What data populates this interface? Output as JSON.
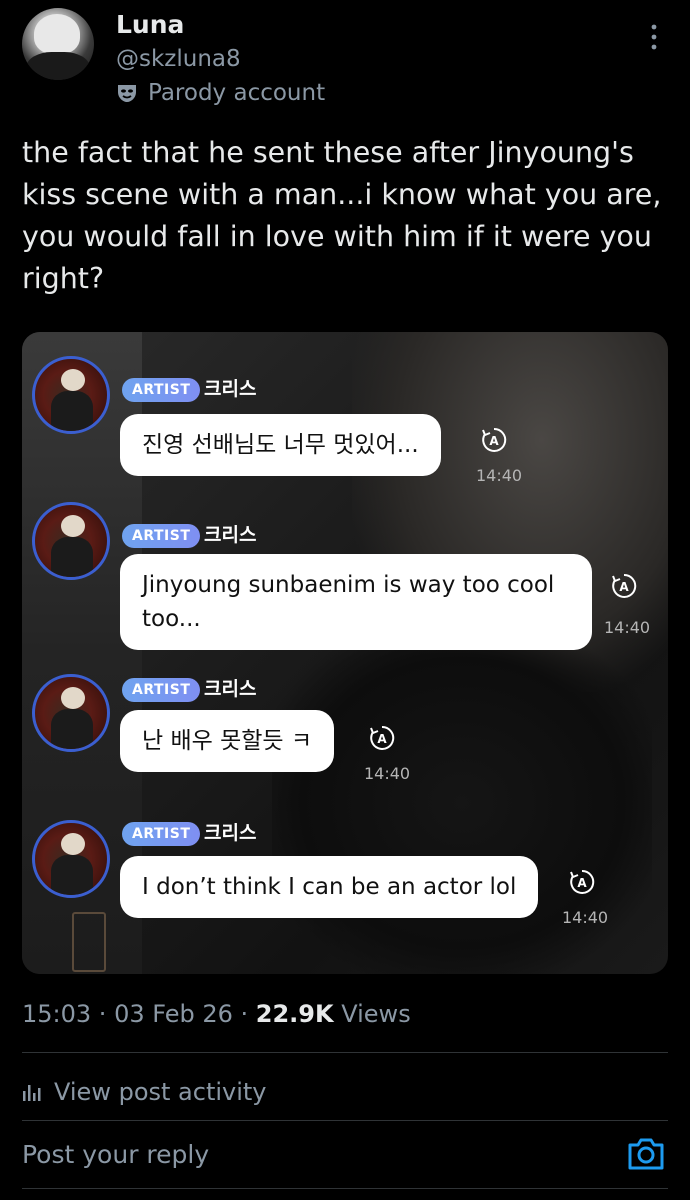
{
  "profile": {
    "name": "Luna",
    "handle": "@skzluna8",
    "label": "Parody account"
  },
  "tweet": {
    "text": "the fact that he sent these after Jinyoung's kiss scene with a man...i know what you are,  you would fall in love with him if it were you right?"
  },
  "messages": [
    {
      "badge": "ARTIST",
      "sender": "크리스",
      "text": "진영 선배님도 너무 멋있어...",
      "time": "14:40"
    },
    {
      "badge": "ARTIST",
      "sender": "크리스",
      "text": "Jinyoung sunbaenim is way too cool too...",
      "time": "14:40"
    },
    {
      "badge": "ARTIST",
      "sender": "크리스",
      "text": "난 배우 못할듯 ㅋ",
      "time": "14:40"
    },
    {
      "badge": "ARTIST",
      "sender": "크리스",
      "text": "I don’t think I can be an actor lol",
      "time": "14:40"
    }
  ],
  "meta": {
    "time": "15:03",
    "date": "03 Feb 26",
    "views_count": "22.9K",
    "views_label": "Views",
    "sep": " · "
  },
  "activity": {
    "label": "View post activity"
  },
  "reply": {
    "placeholder": "Post your reply"
  },
  "icons": {
    "avatar": "profile-avatar",
    "parody": "mask-icon",
    "more": "more-options-icon",
    "translate": "translate-icon",
    "activity": "bar-chart-icon",
    "camera": "camera-icon"
  },
  "colors": {
    "background": "#000000",
    "text": "#e7e9ea",
    "muted": "#8b98a5",
    "accent": "#1d9bf0",
    "badge": "#6fa3ef",
    "bubble": "#ffffff"
  }
}
